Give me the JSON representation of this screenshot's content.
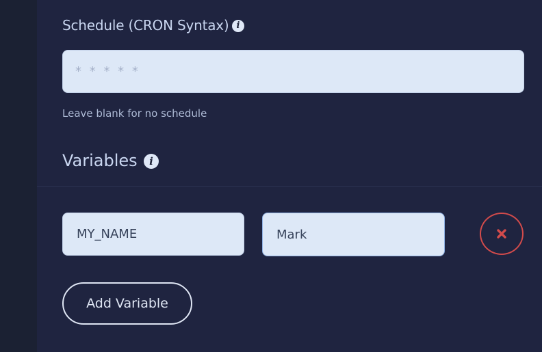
{
  "schedule": {
    "label": "Schedule (CRON Syntax)",
    "info_icon": "info-icon",
    "placeholder": "* * * * *",
    "value": "",
    "hint": "Leave blank for no schedule"
  },
  "variables": {
    "heading": "Variables",
    "info_icon": "info-icon",
    "items": [
      {
        "name": "MY_NAME",
        "value": "Mark",
        "remove_icon": "close-icon"
      }
    ],
    "add_label": "Add Variable"
  },
  "colors": {
    "background": "#1d2237",
    "input_background": "#dde8f7",
    "remove_accent": "#d24b4b",
    "text": "#c9d6f0"
  }
}
